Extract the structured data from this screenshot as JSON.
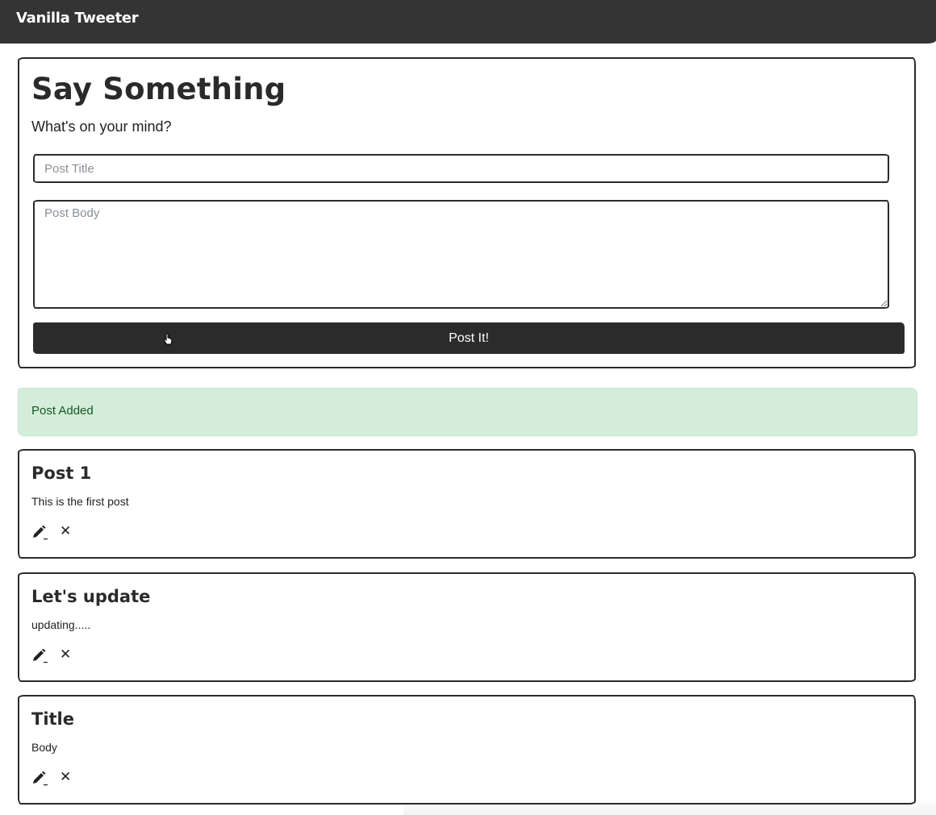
{
  "navbar": {
    "brand": "Vanilla Tweeter"
  },
  "form": {
    "title": "Say Something",
    "subtitle": "What's on your mind?",
    "title_placeholder": "Post Title",
    "body_placeholder": "Post Body",
    "submit_label": "Post It!"
  },
  "alert": {
    "message": "Post Added",
    "color": "#d4edda"
  },
  "posts": [
    {
      "title": "Post 1",
      "body": "This is the first post"
    },
    {
      "title": "Let's update",
      "body": "updating....."
    },
    {
      "title": "Title",
      "body": "Body"
    }
  ],
  "icons": {
    "edit": "pencil-icon",
    "delete": "close-icon",
    "delete_glyph": "✕"
  },
  "colors": {
    "navbar": "#343434",
    "button": "#2b2b2b",
    "alert_text": "#155724"
  }
}
